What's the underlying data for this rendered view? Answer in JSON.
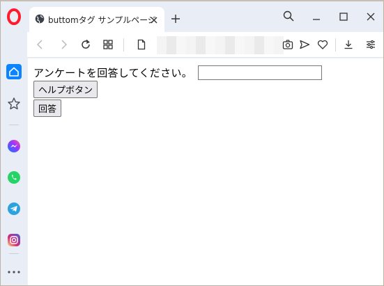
{
  "browser": {
    "tab_title": "buttomタグ サンプルページ",
    "url": ""
  },
  "colors": {
    "opera_red": "#ff1b2d",
    "sidebar_bg": "#e9eef6",
    "home_active": "#0a84ff",
    "messenger": "#a033ff",
    "whatsapp": "#25d366",
    "telegram": "#2aa3e0",
    "instagram": "#e1306c"
  },
  "sidebar": {
    "items": [
      "opera-logo",
      "home-icon",
      "star-icon",
      "messenger-icon",
      "whatsapp-icon",
      "telegram-icon",
      "instagram-icon",
      "more-icon"
    ]
  },
  "page": {
    "question_text": "アンケートを回答してください。",
    "answer_input_value": "",
    "help_button_label": "ヘルプボタン",
    "submit_button_label": "回答"
  }
}
